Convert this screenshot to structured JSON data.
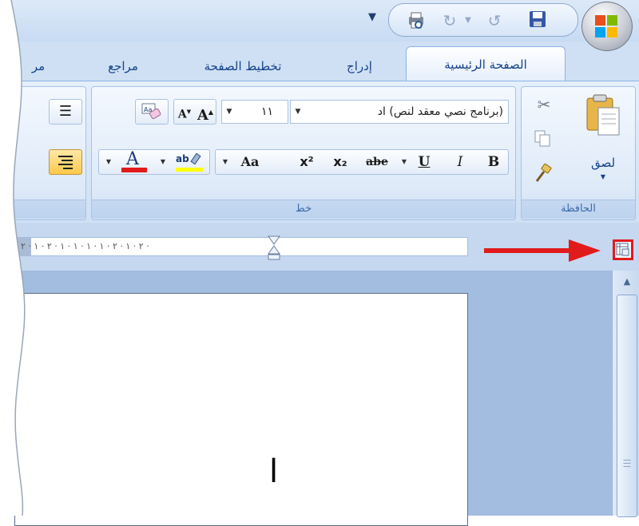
{
  "tabs": {
    "home": "الصفحة الرئيسية",
    "insert": "إدراج",
    "page_layout": "تخطيط الصفحة",
    "references": "مراجع",
    "partial": "مر"
  },
  "quick_access": {
    "customize_icon": "qat-customize-arrow-icon",
    "items": [
      "print-preview-icon",
      "redo-icon",
      "undo-icon",
      "save-icon"
    ]
  },
  "clipboard": {
    "paste_label": "لصق",
    "group_label": "الحافظة"
  },
  "font": {
    "name": "(برنامج نصي معقد لنص) اد",
    "size": "١١",
    "group_label": "خط",
    "bold": "B",
    "italic": "I",
    "underline": "U",
    "strikethrough": "abe",
    "subscript": "x₂",
    "superscript": "x²",
    "change_case": "Aa",
    "grow": "A",
    "shrink": "A",
    "font_color_letter": "A",
    "highlight_letters": "ab"
  },
  "ruler": {
    "marks": "· ٢ · ١ · ٢ · ١ · ١ · ١ · ١ · ٢ · ١ · ٢ ·"
  },
  "document": {
    "text": "ا"
  },
  "colors": {
    "accent_red": "#e01b1b",
    "font_color": "#e01b1b",
    "highlight": "#ffff00",
    "ribbon_text": "#15428b"
  }
}
